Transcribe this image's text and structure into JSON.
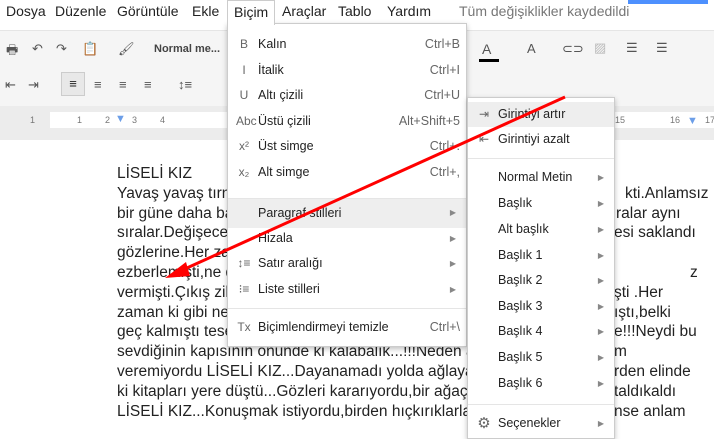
{
  "menubar": {
    "items": [
      "Dosya",
      "Düzenle",
      "Görüntüle",
      "Ekle",
      "Biçim",
      "Araçlar",
      "Tablo",
      "Yardım"
    ],
    "status": "Tüm değişiklikler kaydedildi"
  },
  "toolbar": {
    "style_select": "Normal me..."
  },
  "ruler": {
    "labels": [
      "1",
      "1",
      "2",
      "3",
      "4",
      "15",
      "16",
      "17"
    ]
  },
  "document": {
    "lines": [
      [
        "LİSELİ KIZ",
        ""
      ],
      [
        "Yavaş yavaş tırn",
        "kti.Anlamsız"
      ],
      [
        "bir güne daha ba",
        "ralar aynı"
      ],
      [
        "sıralar.Değişece",
        "esi saklandı"
      ],
      [
        "gözlerine.Her za",
        ""
      ],
      [
        "ezberlemişti,ne d",
        "z"
      ],
      [
        "vermişti.Çıkış zil",
        "şti .Her"
      ],
      [
        "zaman ki gibi ne",
        "ıştı,belki"
      ],
      [
        "geç kalmıştı tese",
        "e!!!Neydi bu"
      ],
      [
        "sevdiğinin kapısının önünde ki kalabalık...!!!Neden ağ",
        "m"
      ],
      [
        "veremiyordu LİSELİ KIZ...Dayanamadı yolda ağlayar",
        "rden elinde"
      ],
      [
        "ki kitapları yere düştü...Gözleri kararıyordu,bir ağaç f",
        "taldıkaldı"
      ],
      [
        "LİSELİ KIZ...Konuşmak istiyordu,birden hıçkırıklarla a",
        "nse anlam"
      ]
    ]
  },
  "format_menu": {
    "items": [
      {
        "icon": "bold-icon",
        "glyph": "B",
        "label": "Kalın",
        "shortcut": "Ctrl+B"
      },
      {
        "icon": "italic-icon",
        "glyph": "I",
        "label": "İtalik",
        "shortcut": "Ctrl+I"
      },
      {
        "icon": "underline-icon",
        "glyph": "U",
        "label": "Altı çizili",
        "shortcut": "Ctrl+U"
      },
      {
        "icon": "strikethrough-icon",
        "glyph": "Abc",
        "label": "Üstü çizili",
        "shortcut": "Alt+Shift+5"
      },
      {
        "icon": "superscript-icon",
        "glyph": "x²",
        "label": "Üst simge",
        "shortcut": "Ctrl+."
      },
      {
        "icon": "subscript-icon",
        "glyph": "x₂",
        "label": "Alt simge",
        "shortcut": "Ctrl+,"
      },
      {
        "icon": "",
        "glyph": "",
        "label": "Paragraf stilleri",
        "shortcut": ""
      },
      {
        "icon": "",
        "glyph": "",
        "label": "Hizala",
        "shortcut": ""
      },
      {
        "icon": "line-spacing-icon",
        "glyph": "↕≡",
        "label": "Satır aralığı",
        "shortcut": ""
      },
      {
        "icon": "list-icon",
        "glyph": "⁝≡",
        "label": "Liste stilleri",
        "shortcut": ""
      },
      {
        "icon": "clear-format-icon",
        "glyph": "Tx",
        "label": "Biçimlendirmeyi temizle",
        "shortcut": "Ctrl+\\"
      }
    ]
  },
  "paragraph_submenu": {
    "items": [
      "Girintiyi artır",
      "Girintiyi azalt",
      "Normal Metin",
      "Başlık",
      "Alt başlık",
      "Başlık 1",
      "Başlık 2",
      "Başlık 3",
      "Başlık 4",
      "Başlık 5",
      "Başlık 6",
      "Seçenekler"
    ]
  },
  "colors": {
    "arrow": "#ff0000",
    "highlight": "#eeeeee"
  }
}
